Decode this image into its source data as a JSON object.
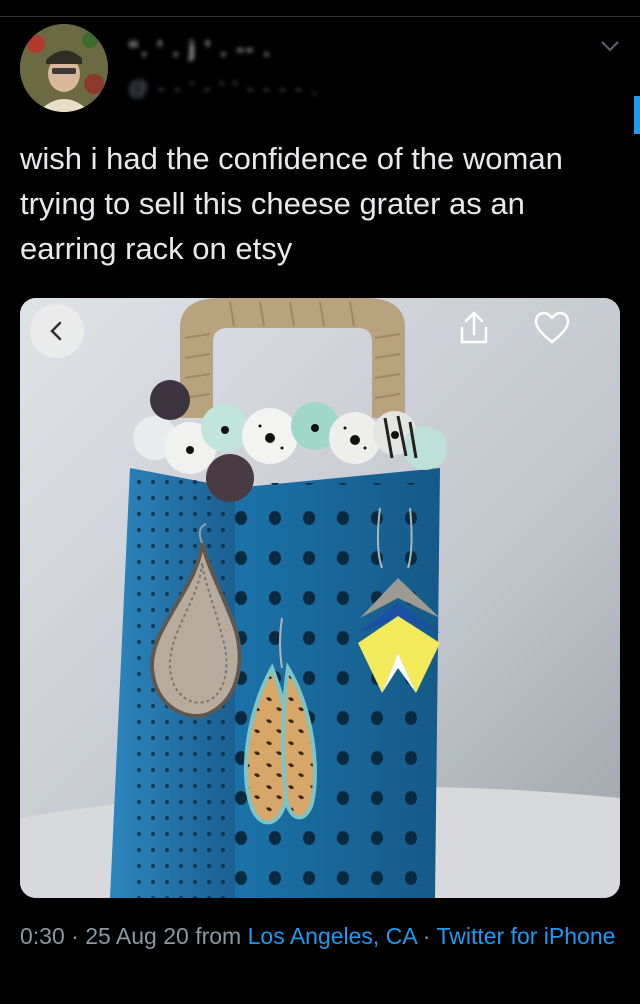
{
  "author": {
    "display_name": "“. ' . j ' . -- .",
    "handle": "@ - - ' - ' ' - - - - ."
  },
  "tweet": {
    "text": "wish i had the confidence of the woman trying to sell this cheese grater as an earring rack on etsy"
  },
  "media": {
    "icons": [
      "back-chevron-icon",
      "share-icon",
      "heart-icon"
    ]
  },
  "meta": {
    "time": "0:30",
    "sep1": " · ",
    "date": "25 Aug 20",
    "from_word": " from ",
    "location": "Los Angeles, CA",
    "sep2": " · ",
    "client": "Twitter for iPhone"
  },
  "colors": {
    "background": "#000000",
    "text": "#e7e9ea",
    "secondary": "#8b98a5",
    "link": "#1d9bf0",
    "grater_blue": "#1f6fa3"
  }
}
